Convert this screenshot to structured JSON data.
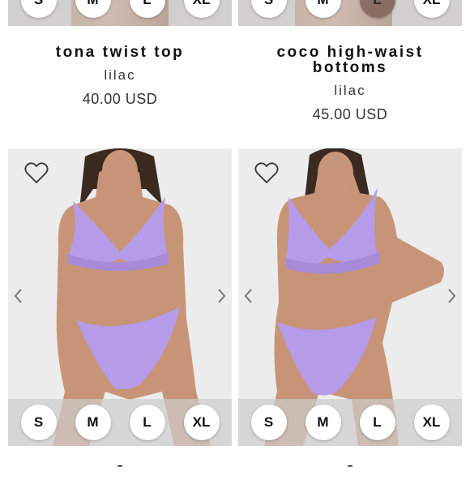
{
  "top_row": {
    "left_sizes": [
      "S",
      "M",
      "L",
      "XL"
    ],
    "right_sizes": [
      "S",
      "M",
      "L",
      "XL"
    ]
  },
  "products": [
    {
      "name": "tona twist top",
      "variant": "lilac",
      "price": "40.00 USD"
    },
    {
      "name": "coco high-waist bottoms",
      "variant": "lilac",
      "price": "45.00 USD"
    }
  ],
  "cards": [
    {
      "sizes": [
        "S",
        "M",
        "L",
        "XL"
      ],
      "favorite_icon": "heart-outline-icon",
      "prev_icon": "chevron-left-icon",
      "next_icon": "chevron-right-icon"
    },
    {
      "sizes": [
        "S",
        "M",
        "L",
        "XL"
      ],
      "favorite_icon": "heart-outline-icon",
      "prev_icon": "chevron-left-icon",
      "next_icon": "chevron-right-icon"
    }
  ],
  "colors": {
    "lilac": "#b69be8",
    "text": "#111111",
    "card_bg": "#ececec"
  }
}
